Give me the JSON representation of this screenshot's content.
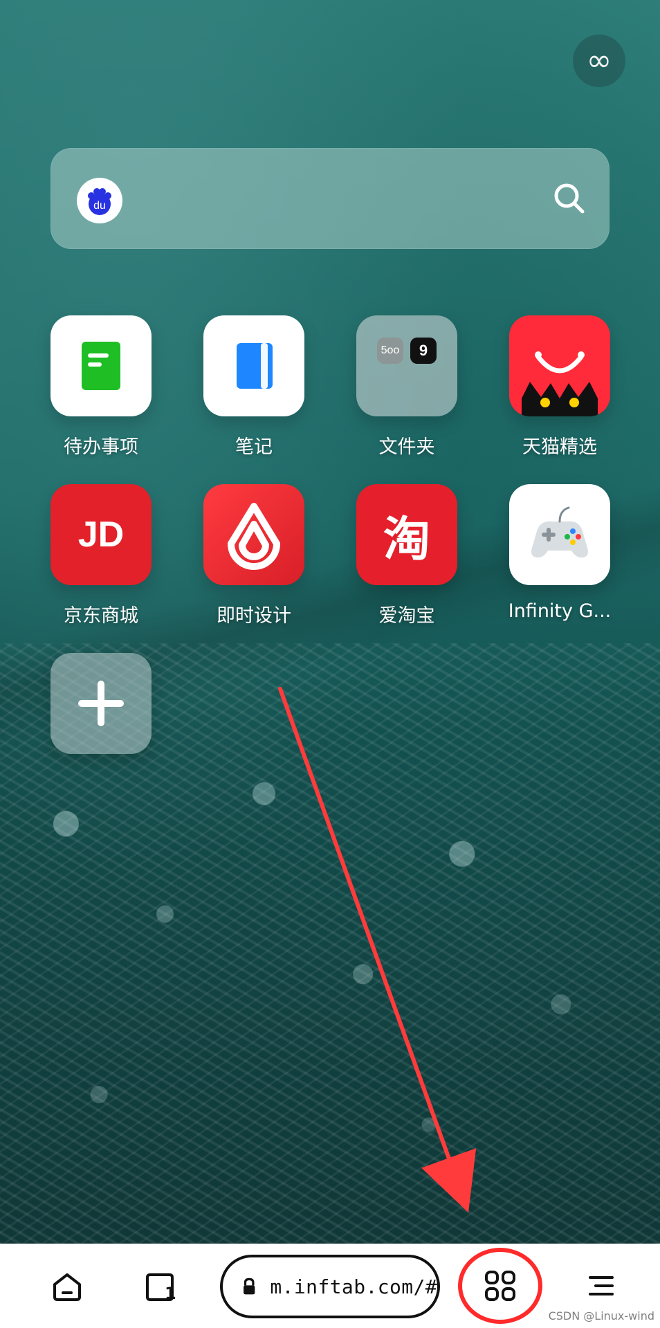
{
  "search": {
    "engine_name": "du",
    "placeholder": ""
  },
  "top_right": {
    "symbol": "∞"
  },
  "shortcuts": [
    {
      "label": "待办事项"
    },
    {
      "label": "笔记"
    },
    {
      "label": "文件夹",
      "badges": [
        "5oo",
        "9"
      ]
    },
    {
      "label": "天猫精选"
    },
    {
      "label": "京东商城",
      "icon_text": "JD"
    },
    {
      "label": "即时设计"
    },
    {
      "label": "爱淘宝",
      "icon_text": "淘"
    },
    {
      "label": "Infinity G..."
    },
    {
      "label": ""
    }
  ],
  "bottom_bar": {
    "tab_count": "1",
    "url": "m.inftab.com/#"
  },
  "watermark": "CSDN @Linux-wind",
  "colors": {
    "green": "#1fbe24",
    "blue": "#1e86ff",
    "red": "#e3212a",
    "red2": "#ff2b3a",
    "white": "#ffffff"
  }
}
